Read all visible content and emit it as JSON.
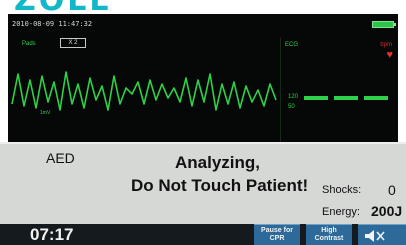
{
  "logo": {
    "text": "ZOLL"
  },
  "monitor": {
    "timestamp": "2010-08-09 11:47:32",
    "lead_label": "Pads",
    "gain": "X 2",
    "ecg_label": "ECG",
    "hr_label": "bpm",
    "hr_scale_high": "120",
    "hr_scale_low": "50",
    "wave_caption": "1mV",
    "colors": {
      "trace": "#2fd04a",
      "heart": "#e8322e",
      "battery": "#2ec44a"
    }
  },
  "status": {
    "mode": "AED",
    "message_line1": "Analyzing,",
    "message_line2": "Do Not Touch Patient!",
    "shocks_label": "Shocks:",
    "shocks_value": "0",
    "energy_label": "Energy:",
    "energy_value": "200J"
  },
  "bottom_bar": {
    "elapsed_time": "07:17",
    "keys": [
      {
        "label_line1": "Pause for",
        "label_line2": "CPR"
      },
      {
        "label_line1": "High",
        "label_line2": "Contrast"
      },
      {
        "icon": "speaker-icon"
      }
    ]
  }
}
